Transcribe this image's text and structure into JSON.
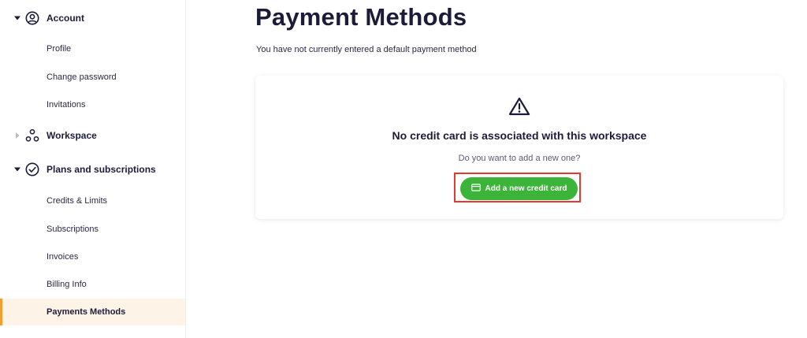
{
  "sidebar": {
    "account": {
      "label": "Account",
      "icon": "user-circle-icon",
      "items": [
        {
          "label": "Profile"
        },
        {
          "label": "Change password"
        },
        {
          "label": "Invitations"
        }
      ]
    },
    "workspace": {
      "label": "Workspace",
      "icon": "workspace-nodes-icon"
    },
    "plans": {
      "label": "Plans and subscriptions",
      "icon": "check-circle-icon",
      "items": [
        {
          "label": "Credits & Limits"
        },
        {
          "label": "Subscriptions"
        },
        {
          "label": "Invoices"
        },
        {
          "label": "Billing Info"
        },
        {
          "label": "Payments Methods",
          "active": true
        }
      ]
    }
  },
  "main": {
    "title": "Payment Methods",
    "subtitle": "You have not currently entered a default payment method",
    "card": {
      "icon": "warning-icon",
      "title": "No credit card is associated with this workspace",
      "subtitle": "Do you want to add a new one?",
      "button_label": "Add a new credit card",
      "button_icon": "credit-card-icon"
    }
  },
  "colors": {
    "accent_orange": "#f59e2e",
    "active_bg": "#fdf3e6",
    "button_green": "#3cb43a",
    "highlight_red": "#e03b2b",
    "text_dark": "#1c1c3a"
  }
}
